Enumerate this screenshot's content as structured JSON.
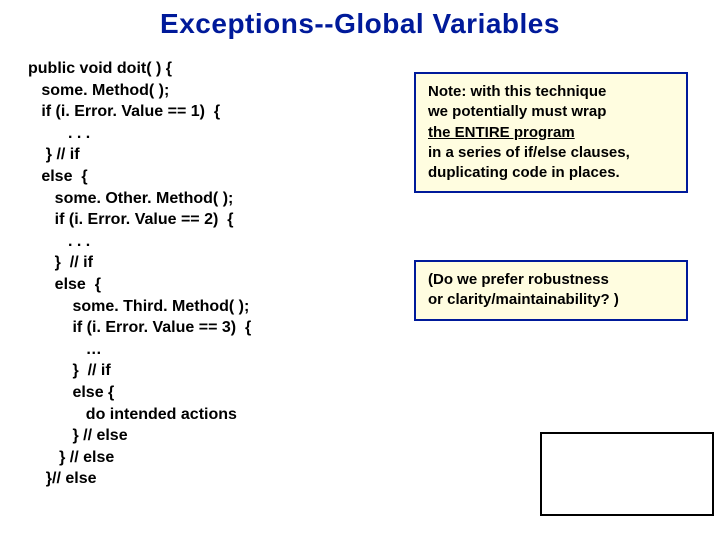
{
  "title": "Exceptions--Global Variables",
  "code": "public void doit( ) {\n   some. Method( );\n   if (i. Error. Value == 1)  {\n         . . .\n    } // if\n   else  {\n      some. Other. Method( );\n      if (i. Error. Value == 2)  {\n         . . .\n      }  // if\n      else  {\n          some. Third. Method( );\n          if (i. Error. Value == 3)  {\n             …\n          }  // if\n          else {\n             do intended actions\n          } // else\n       } // else\n    }// else",
  "note1": {
    "l1": "Note: with this technique",
    "l2": "we potentially must wrap",
    "l3u": "the ENTIRE program",
    "l4": "in a series of if/else clauses,",
    "l5": "duplicating code in places."
  },
  "note2": {
    "l1": "(Do we prefer robustness",
    "l2": " or clarity/maintainability? )"
  }
}
